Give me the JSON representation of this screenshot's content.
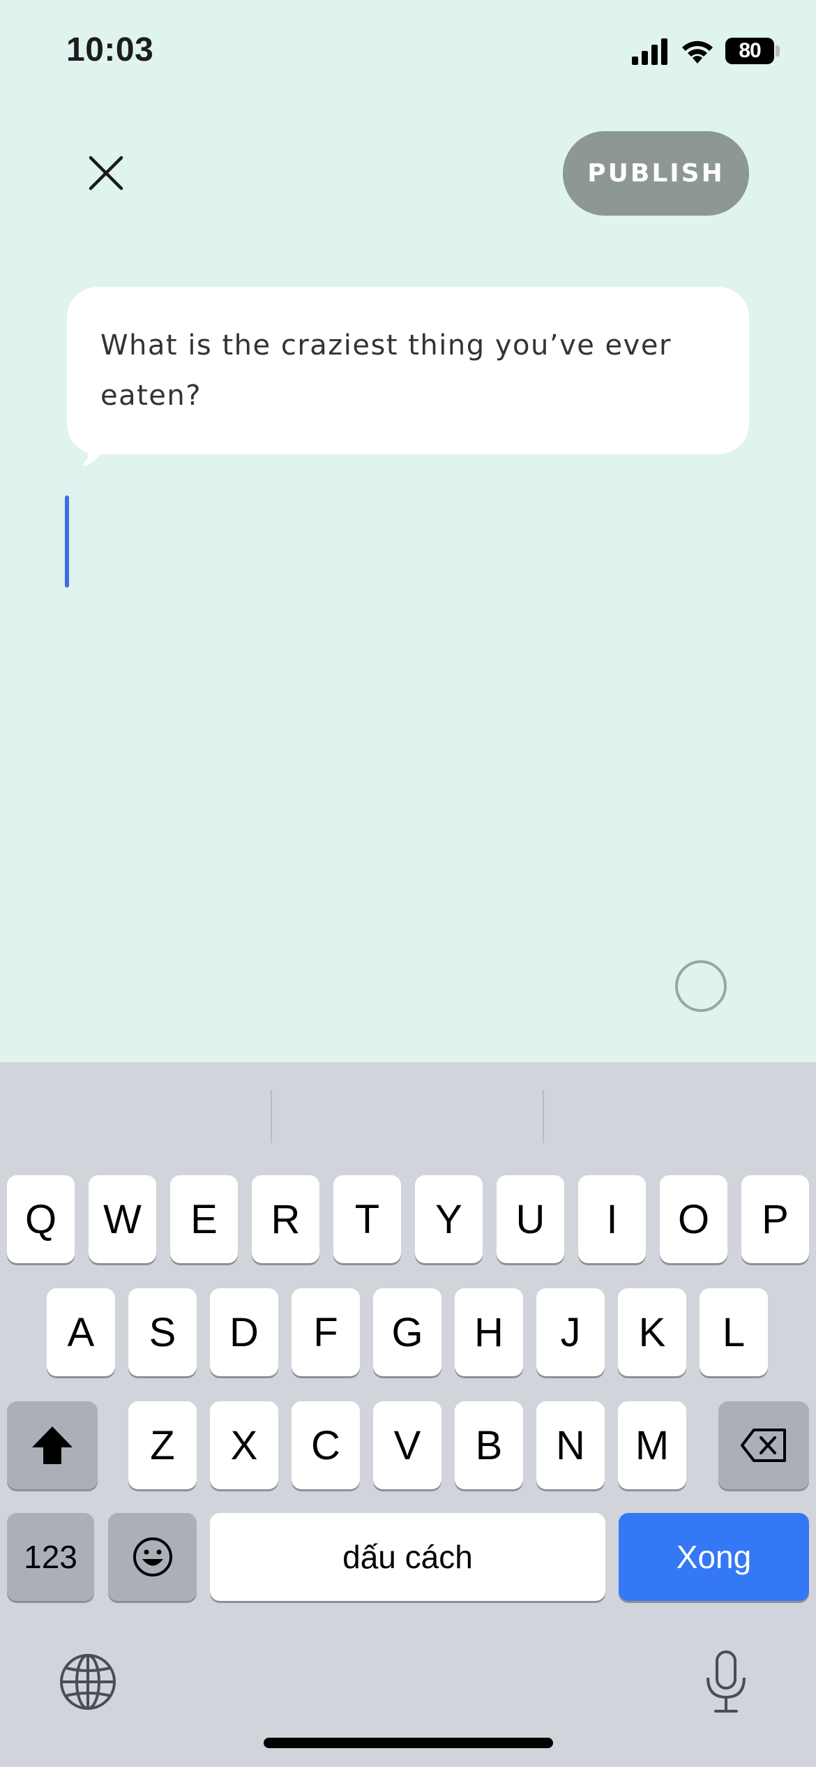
{
  "status_bar": {
    "time": "10:03",
    "battery": "80"
  },
  "header": {
    "close_icon": "close-icon",
    "publish_label": "PUBLISH"
  },
  "prompt": {
    "text": "What is the craziest thing you’ve ever eaten?"
  },
  "colors": {
    "background": "#dff3ef",
    "publish_button": "#8d9795",
    "cursor": "#3c6ee4",
    "keyboard_background": "#d1d5db",
    "done_key": "#3478f6"
  },
  "keyboard": {
    "row1": [
      "Q",
      "W",
      "E",
      "R",
      "T",
      "Y",
      "U",
      "I",
      "O",
      "P"
    ],
    "row2": [
      "A",
      "S",
      "D",
      "F",
      "G",
      "H",
      "J",
      "K",
      "L"
    ],
    "row3": [
      "Z",
      "X",
      "C",
      "V",
      "B",
      "N",
      "M"
    ],
    "shift_icon": "shift-icon",
    "delete_icon": "backspace-icon",
    "numbers_label": "123",
    "emoji_icon": "emoji-icon",
    "space_label": "dấu cách",
    "done_label": "Xong",
    "globe_icon": "globe-icon",
    "mic_icon": "microphone-icon"
  }
}
